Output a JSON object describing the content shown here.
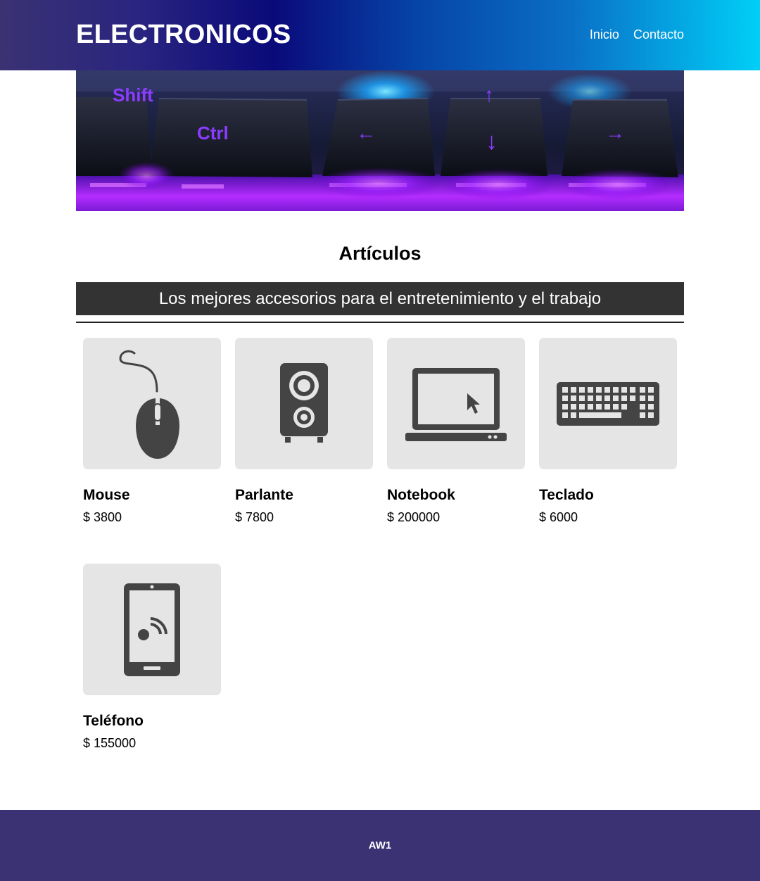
{
  "header": {
    "brand": "ELECTRONICOS",
    "nav": [
      {
        "label": "Inicio"
      },
      {
        "label": "Contacto"
      }
    ]
  },
  "banner": {
    "keycaps": [
      "Shift",
      "Ctrl",
      "←",
      "↓",
      "↑",
      "→"
    ]
  },
  "section": {
    "title": "Artículos",
    "tagline": "Los mejores accesorios para el entretenimiento y el trabajo"
  },
  "products": [
    {
      "name": "Mouse",
      "price": "$ 3800",
      "icon": "mouse-icon"
    },
    {
      "name": "Parlante",
      "price": "$ 7800",
      "icon": "speaker-icon"
    },
    {
      "name": "Notebook",
      "price": "$ 200000",
      "icon": "laptop-icon"
    },
    {
      "name": "Teclado",
      "price": "$ 6000",
      "icon": "keyboard-icon"
    },
    {
      "name": "Teléfono",
      "price": "$ 155000",
      "icon": "smartphone-icon"
    }
  ],
  "footer": {
    "text": "AW1"
  },
  "colors": {
    "header_gradient_start": "#3a3273",
    "header_gradient_end": "#00cff7",
    "tagline_bg": "#333333",
    "card_bg": "#e5e5e5",
    "icon": "#444444",
    "footer_bg": "#3a3273"
  }
}
